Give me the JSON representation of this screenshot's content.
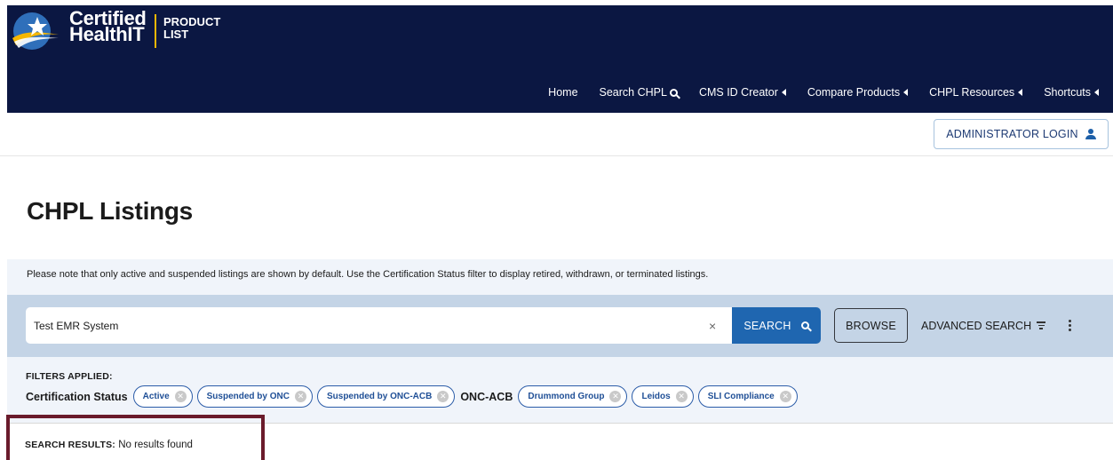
{
  "header": {
    "brand_line1": "Certified",
    "brand_line2": "HealthIT",
    "product_line1": "PRODUCT",
    "product_line2": "LIST",
    "logo_icon": "star-swoosh-logo",
    "colors": {
      "background": "#0b1742",
      "accent": "#f5b700"
    }
  },
  "nav": {
    "items": [
      {
        "label": "Home"
      },
      {
        "label": "Search CHPL",
        "icon": "search-icon"
      },
      {
        "label": "CMS ID Creator",
        "icon": "caret-left-icon"
      },
      {
        "label": "Compare Products",
        "icon": "caret-left-icon"
      },
      {
        "label": "CHPL Resources",
        "icon": "caret-left-icon"
      },
      {
        "label": "Shortcuts",
        "icon": "caret-left-icon"
      }
    ]
  },
  "admin": {
    "login_label": "ADMINISTRATOR LOGIN",
    "icon": "user-icon"
  },
  "page": {
    "title": "CHPL Listings"
  },
  "notice": "Please note that only active and suspended listings are shown by default. Use the Certification Status filter to display retired, withdrawn, or terminated listings.",
  "search": {
    "value": "Test EMR System",
    "clear": "×",
    "search_label": "SEARCH",
    "browse_label": "BROWSE",
    "advanced_label": "ADVANCED SEARCH",
    "colors": {
      "search_button": "#1f66b0",
      "bar": "#c4d4e6"
    }
  },
  "filters": {
    "title": "FILTERS APPLIED:",
    "groups": [
      {
        "label": "Certification Status",
        "chips": [
          "Active",
          "Suspended by ONC",
          "Suspended by ONC-ACB"
        ]
      },
      {
        "label": "ONC-ACB",
        "chips": [
          "Drummond Group",
          "Leidos",
          "SLI Compliance"
        ]
      }
    ]
  },
  "results": {
    "label": "SEARCH RESULTS:",
    "value": "No results found",
    "highlight_color": "#6a1b2b"
  }
}
